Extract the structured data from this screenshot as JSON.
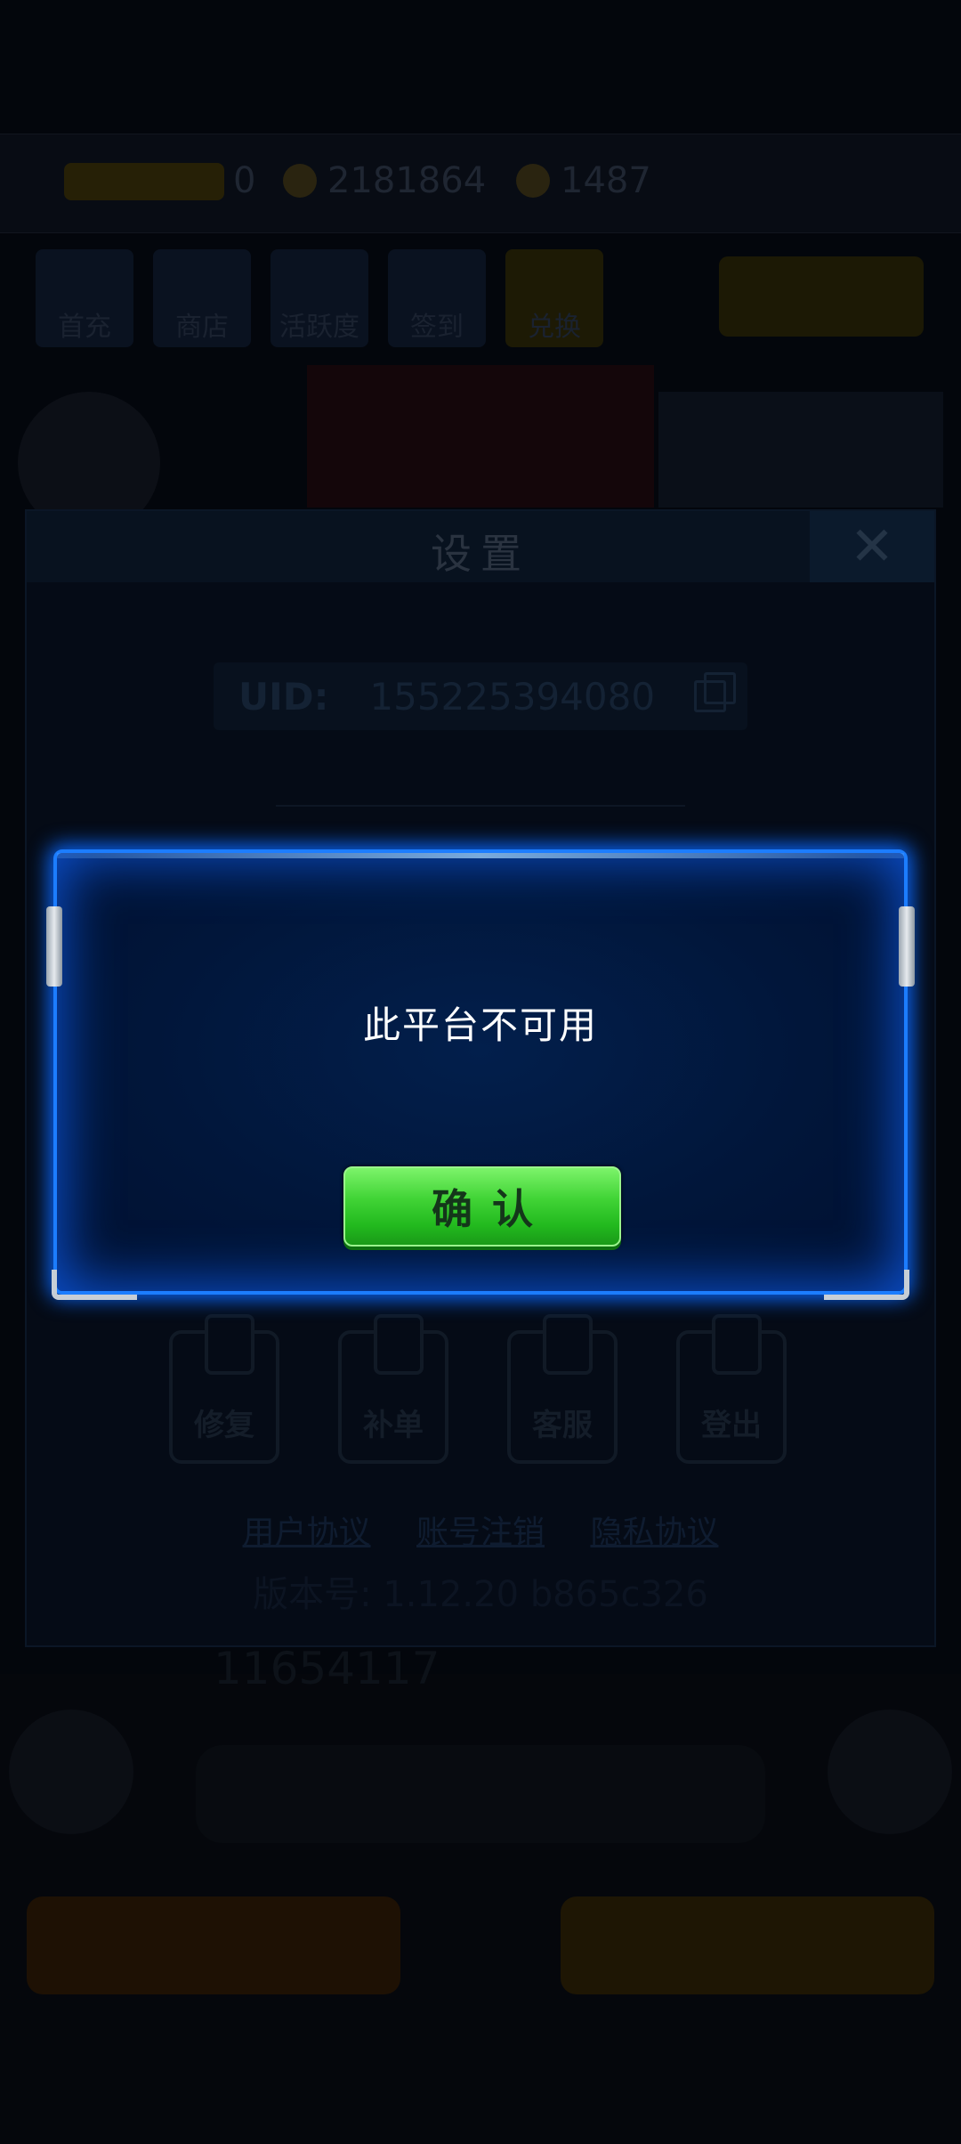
{
  "background": {
    "top_values": [
      "0",
      "2181864",
      "1487"
    ],
    "menu_items": [
      "首充",
      "商店",
      "活跃度",
      "签到",
      "兑换"
    ],
    "uid_hint": "11654117"
  },
  "settings": {
    "title": "设置",
    "close_label": "✕",
    "uid_label": "UID:",
    "uid_value": "155225394080",
    "actions": [
      "修复",
      "补单",
      "客服",
      "登出"
    ],
    "links": [
      "用户协议",
      "账号注销",
      "隐私协议"
    ],
    "version": "版本号: 1.12.20 b865c326"
  },
  "dialog": {
    "message": "此平台不可用",
    "confirm_label": "确认"
  },
  "colors": {
    "dialog_border": "#1c7dff",
    "dialog_fill": "#01163a",
    "confirm_green": "#41d436"
  }
}
